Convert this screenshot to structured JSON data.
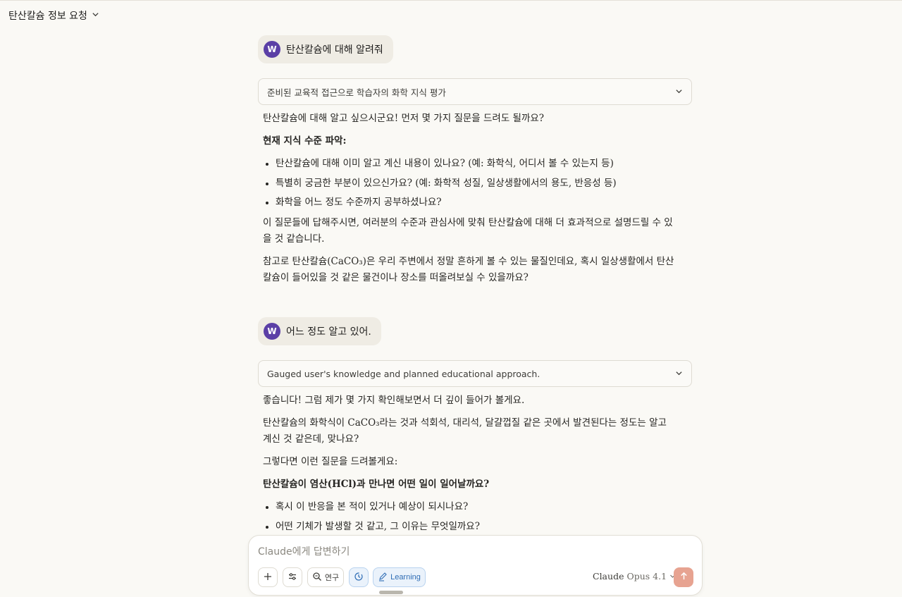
{
  "header": {
    "chat_title": "탄산칼슘 정보 요청"
  },
  "user": {
    "avatar_letter": "W"
  },
  "messages": [
    {
      "user_text": "탄산칼슘에 대해 알려줘",
      "thinking_summary": "준비된 교육적 접근으로 학습자의 화학 지식 평가",
      "response": {
        "p1": "탄산칼슘에 대해 알고 싶으시군요! 먼저 몇 가지 질문을 드려도 될까요?",
        "heading": "현재 지식 수준 파악:",
        "bullets": [
          "탄산칼슘에 대해 이미 알고 계신 내용이 있나요? (예: 화학식, 어디서 볼 수 있는지 등)",
          "특별히 궁금한 부분이 있으신가요? (예: 화학적 성질, 일상생활에서의 용도, 반응성 등)",
          "화학을 어느 정도 수준까지 공부하셨나요?"
        ],
        "p2": "이 질문들에 답해주시면, 여러분의 수준과 관심사에 맞춰 탄산칼슘에 대해 더 효과적으로 설명드릴 수 있을 것 같습니다.",
        "p3": "참고로 탄산칼슘(CaCO₃)은 우리 주변에서 정말 흔하게 볼 수 있는 물질인데요, 혹시 일상생활에서 탄산칼슘이 들어있을 것 같은 물건이나 장소를 떠올려보실 수 있을까요?"
      }
    },
    {
      "user_text": "어느 정도 알고 있어.",
      "thinking_summary": "Gauged user's knowledge and planned educational approach.",
      "response": {
        "p1": "좋습니다! 그럼 제가 몇 가지 확인해보면서 더 깊이 들어가 볼게요.",
        "p2": "탄산칼슘의 화학식이 CaCO₃라는 것과 석회석, 대리석, 달걀껍질 같은 곳에서 발견된다는 정도는 알고 계신 것 같은데, 맞나요?",
        "p3": "그렇다면 이런 질문을 드려볼게요:",
        "heading": "탄산칼슘이 염산(HCl)과 만나면 어떤 일이 일어날까요?",
        "bullets": [
          "혹시 이 반응을 본 적이 있거나 예상이 되시나요?",
          "어떤 기체가 발생할 것 같고, 그 이유는 무엇일까요?"
        ]
      }
    }
  ],
  "composer": {
    "placeholder": "Claude에게 답변하기",
    "research_label": "연구",
    "learning_label": "Learning",
    "model_name": "Claude",
    "model_version": "Opus 4.1"
  },
  "icons": {
    "add": "plus-icon",
    "settings": "sliders-icon",
    "research": "search-icon",
    "history": "clock-icon",
    "learning": "pen-icon",
    "send": "arrow-up-icon",
    "dropdown": "chevron-down-icon"
  },
  "colors": {
    "background": "#faf9f5",
    "avatar": "#5b3fa6",
    "send_button": "#e7a391",
    "learning_accent": "#2f6db5"
  }
}
